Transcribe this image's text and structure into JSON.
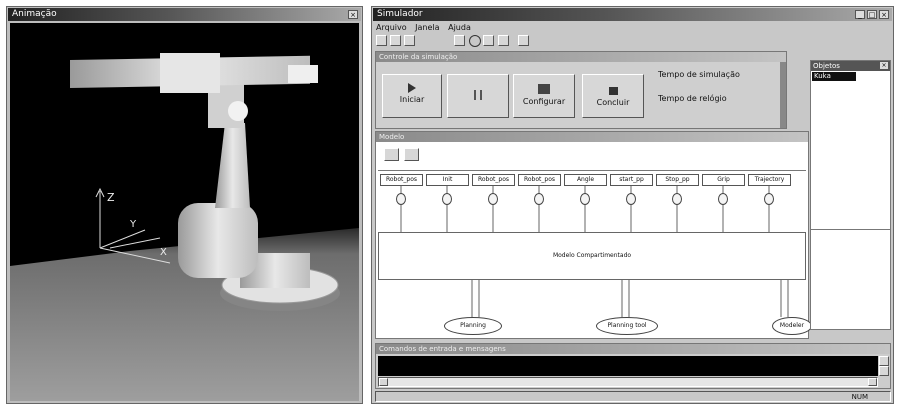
{
  "animation_window": {
    "title": "Animação",
    "axes": {
      "z": "Z",
      "y": "Y",
      "x": "X"
    }
  },
  "simulator_window": {
    "title": "Simulador",
    "menu": [
      "Arquivo",
      "Janela",
      "Ajuda"
    ],
    "control": {
      "header": "Controle da simulação",
      "buttons": [
        {
          "label": "Iniciar",
          "icon": "play-icon"
        },
        {
          "label": "",
          "icon": "pause-icon"
        },
        {
          "label": "Configurar",
          "icon": "config-icon"
        },
        {
          "label": "Concluir",
          "icon": "stop-icon"
        }
      ],
      "sim_time_label": "Tempo de simulação",
      "clock_time_label": "Tempo de relógio"
    },
    "model_header": "Modelo",
    "blocks": [
      "Robot_pos",
      "Init",
      "Robot_pos",
      "Robot_pos",
      "Angle",
      "start_pp",
      "Stop_pp",
      "Grip",
      "Trajectory"
    ],
    "main_block_label": "Modelo Compartimentado",
    "ellipses": [
      "Planning",
      "Planning tool",
      "Modeler"
    ],
    "objects_panel": {
      "title": "Objetos",
      "items": [
        "Kuka"
      ]
    },
    "console_header": "Comandos de entrada e mensagens",
    "status": "NUM"
  }
}
